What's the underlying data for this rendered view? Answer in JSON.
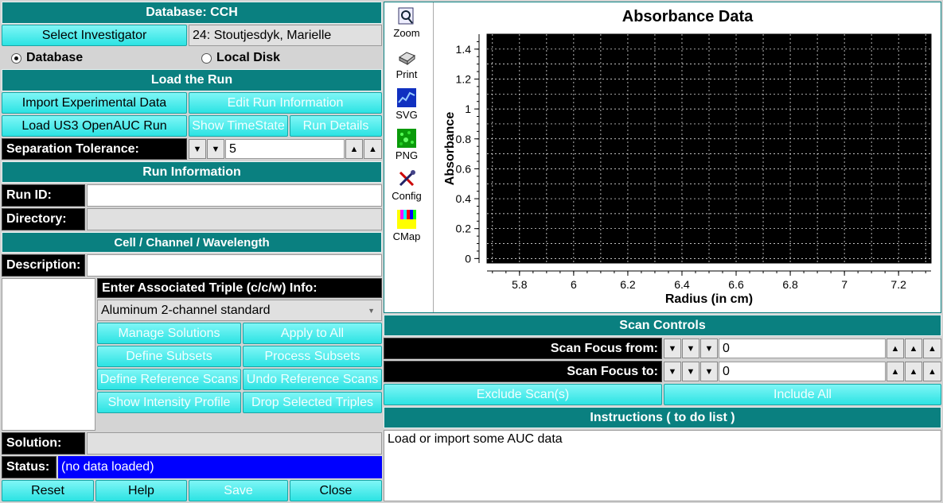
{
  "db_title": "Database: CCH",
  "investigator": {
    "button": "Select Investigator",
    "value": "24: Stoutjesdyk, Marielle"
  },
  "source": {
    "database": "Database",
    "local_disk": "Local Disk",
    "selected": "database"
  },
  "load_run": {
    "title": "Load the Run",
    "import_button": "Import Experimental Data",
    "edit_button": "Edit Run Information",
    "load_button": "Load US3 OpenAUC Run",
    "timestate_button": "Show TimeState",
    "details_button": "Run Details"
  },
  "separation": {
    "label": "Separation Tolerance:",
    "value": "5"
  },
  "run_info": {
    "title": "Run Information",
    "run_id_label": "Run ID:",
    "run_id": "",
    "directory_label": "Directory:",
    "directory": ""
  },
  "ccw": {
    "title": "Cell / Channel / Wavelength",
    "description_label": "Description:",
    "description": "",
    "triple_label": "Enter Associated Triple (c/c/w) Info:",
    "centerpiece": "Aluminum 2-channel standard",
    "buttons": [
      "Manage Solutions",
      "Apply to All",
      "Define Subsets",
      "Process Subsets",
      "Define Reference Scans",
      "Undo Reference Scans",
      "Show Intensity Profile",
      "Drop Selected Triples"
    ],
    "solution_label": "Solution:",
    "solution": ""
  },
  "status": {
    "label": "Status:",
    "value": "(no data loaded)"
  },
  "footer": {
    "reset": "Reset",
    "help": "Help",
    "save": "Save",
    "close": "Close"
  },
  "toolbar": [
    {
      "label": "Zoom",
      "icon": "zoom-icon"
    },
    {
      "label": "Print",
      "icon": "print-icon"
    },
    {
      "label": "SVG",
      "icon": "svg-icon"
    },
    {
      "label": "PNG",
      "icon": "png-icon"
    },
    {
      "label": "Config",
      "icon": "config-icon"
    },
    {
      "label": "CMap",
      "icon": "cmap-icon"
    }
  ],
  "chart_data": {
    "type": "line",
    "title": "Absorbance Data",
    "xlabel": "Radius (in cm)",
    "ylabel": "Absorbance",
    "xlim": [
      5.68,
      7.32
    ],
    "ylim": [
      -0.03,
      1.5
    ],
    "xticks": [
      "5.8",
      "6",
      "6.2",
      "6.4",
      "6.6",
      "6.8",
      "7",
      "7.2"
    ],
    "xtick_values": [
      5.8,
      6.0,
      6.2,
      6.4,
      6.6,
      6.8,
      7.0,
      7.2
    ],
    "yticks": [
      "0",
      "0.2",
      "0.4",
      "0.6",
      "0.8",
      "1",
      "1.2",
      "1.4"
    ],
    "ytick_values": [
      0,
      0.2,
      0.4,
      0.6,
      0.8,
      1.0,
      1.2,
      1.4
    ],
    "grid": true,
    "background": "#000000",
    "series": []
  },
  "scan": {
    "title": "Scan Controls",
    "from_label": "Scan Focus from:",
    "from_value": "0",
    "to_label": "Scan Focus to:",
    "to_value": "0",
    "exclude_button": "Exclude Scan(s)",
    "include_button": "Include All"
  },
  "instructions": {
    "title": "Instructions ( to do list )",
    "text": "Load or import some AUC data"
  },
  "colors": {
    "teal": "#0a8080",
    "button": "#2ce3e3",
    "status_bg": "#0000ff"
  }
}
